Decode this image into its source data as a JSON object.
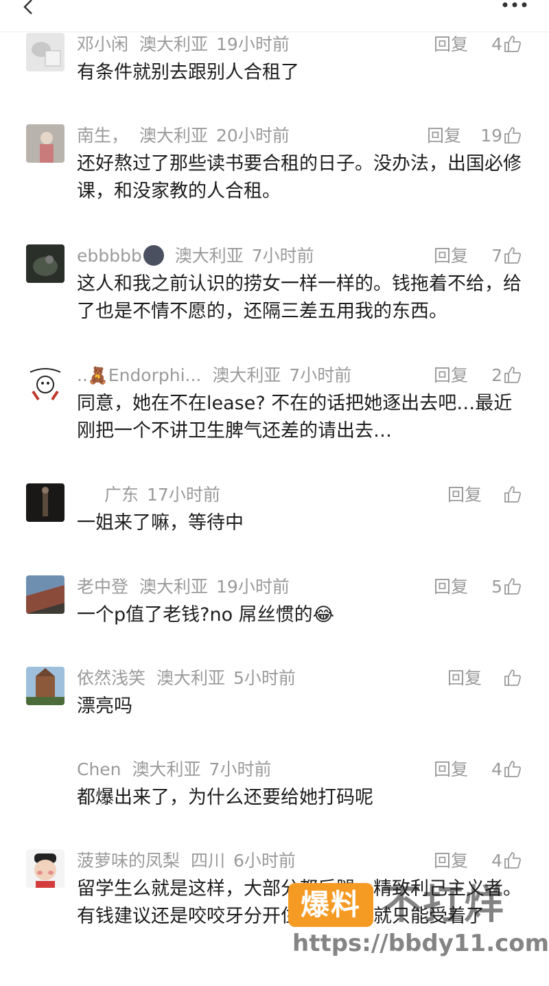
{
  "header": {
    "back_icon": "chevron-left-icon",
    "more_icon": "more-dots-icon"
  },
  "reply_label": "回复",
  "comments": [
    {
      "user": "邓小闲",
      "location": "澳大利亚",
      "time": "19小时前",
      "likes": "4",
      "text": "有条件就别去跟别人合租了"
    },
    {
      "user": "南生，",
      "location": "澳大利亚",
      "time": "20小时前",
      "likes": "19",
      "text": "还好熬过了那些读书要合租的日子。没办法，出国必修课，和没家教的人合租。"
    },
    {
      "user": "ebbbbb",
      "location": "澳大利亚",
      "time": "7小时前",
      "likes": "7",
      "text": "这人和我之前认识的捞女一样一样的。钱拖着不给，给了也是不情不愿的，还隔三差五用我的东西。"
    },
    {
      "user_prefix": "..",
      "user": "Endorphi...",
      "location": "澳大利亚",
      "time": "7小时前",
      "likes": "2",
      "text": "同意，她在不在lease? 不在的话把她逐出去吧…最近刚把一个不讲卫生脾气还差的请出去…"
    },
    {
      "user": "",
      "location": "广东",
      "time": "17小时前",
      "likes": "",
      "text": "一姐来了嘛，等待中"
    },
    {
      "user": "老中登",
      "location": "澳大利亚",
      "time": "19小时前",
      "likes": "5",
      "text": "一个p值了老钱?no 屌丝惯的😂"
    },
    {
      "user": "依然浅笑",
      "location": "澳大利亚",
      "time": "5小时前",
      "likes": "",
      "text": "漂亮吗"
    },
    {
      "user": "Chen",
      "location": "澳大利亚",
      "time": "7小时前",
      "likes": "4",
      "text": "都爆出来了，为什么还要给她打码呢"
    },
    {
      "user": "菠萝味的凤梨",
      "location": "四川",
      "time": "6小时前",
      "likes": "4",
      "text": "留学生么就是这样，大部分都后腿，精致利己主义者。有钱建议还是咬咬牙分开住，没钱也就只能受着了"
    }
  ],
  "watermark": {
    "logo_text": "爆料",
    "slogan": "不打烊",
    "url": "https://bbdy11.com"
  },
  "colors": {
    "meta_gray": "#9a9a9a",
    "text": "#1c1c1c",
    "watermark_orange": "#f59a23"
  }
}
